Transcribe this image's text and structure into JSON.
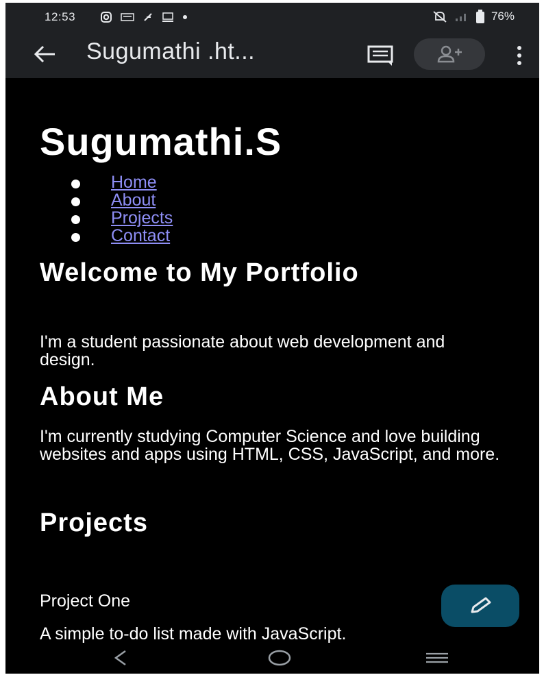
{
  "status_bar": {
    "time": "12:53",
    "battery": "76%",
    "icons_left": [
      "instagram-icon",
      "news-icon",
      "fire-icon",
      "cast-icon",
      "dot-icon"
    ],
    "icons_right": [
      "mute-icon",
      "signal-icon",
      "battery-icon"
    ]
  },
  "app_bar": {
    "title": "Sugumathi .ht...",
    "icons": [
      "back-arrow-icon",
      "comment-icon",
      "add-user-icon",
      "more-vert-icon"
    ]
  },
  "page": {
    "title": "Sugumathi.S",
    "nav": [
      {
        "label": "Home"
      },
      {
        "label": "About"
      },
      {
        "label": "Projects"
      },
      {
        "label": "Contact"
      }
    ],
    "welcome_heading": "Welcome to My Portfolio",
    "welcome_text": "I'm a student passionate about web development and design.",
    "about_heading": "About Me",
    "about_text": "I'm currently studying Computer Science and love building websites and apps using HTML, CSS, JavaScript, and more.",
    "projects_heading": "Projects",
    "project_one_title": "Project One",
    "project_one_desc": "A simple to-do list made with JavaScript."
  },
  "fab": {
    "icon": "pencil-icon"
  },
  "system_nav": {
    "icons": [
      "nav-back-icon",
      "nav-home-icon",
      "nav-recents-icon"
    ]
  },
  "colors": {
    "background": "#000000",
    "bar": "#1f2124",
    "link": "#8e8ef5",
    "fab": "#0a4d66"
  }
}
